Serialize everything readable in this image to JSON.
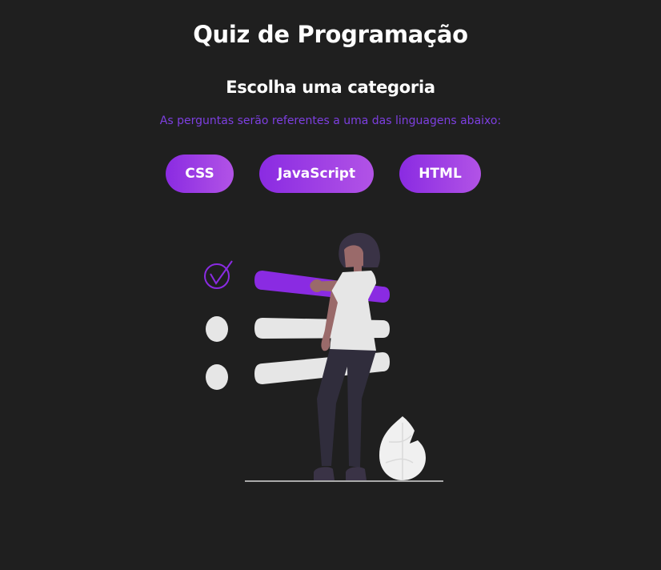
{
  "header": {
    "title": "Quiz de Programação",
    "subtitle": "Escolha uma categoria",
    "description": "As perguntas serão referentes a uma das linguagens abaixo:"
  },
  "categories": [
    {
      "label": "CSS"
    },
    {
      "label": "JavaScript"
    },
    {
      "label": "HTML"
    }
  ],
  "colors": {
    "background": "#1f1f1f",
    "accent": "#8a2be2",
    "accent_light": "#b253e6",
    "description_text": "#7d3fe0",
    "text": "#ffffff"
  }
}
